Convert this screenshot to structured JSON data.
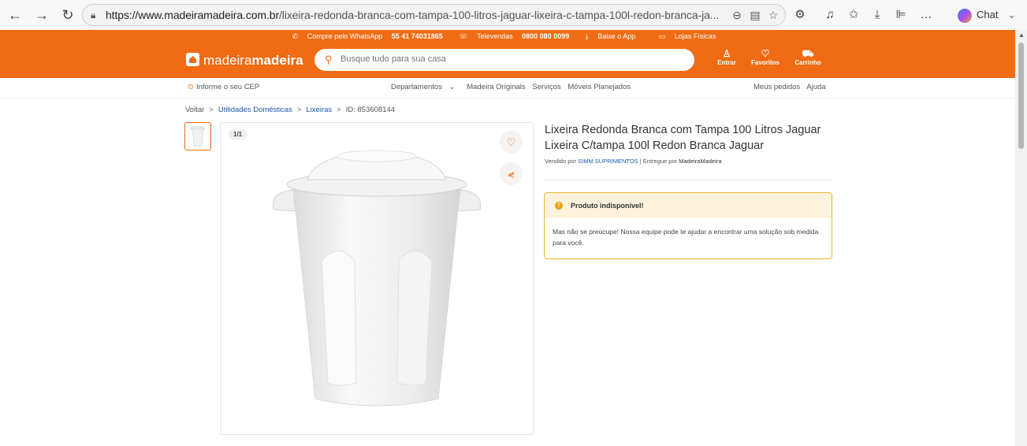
{
  "browser": {
    "url_host": "https://www.madeiramadeira.com.br",
    "url_path": "/lixeira-redonda-branca-com-tampa-100-litros-jaguar-lixeira-c-tampa-100l-redon-branca-ja...",
    "chat_label": "Chat"
  },
  "topstrip": {
    "whatsapp_prefix": "Compre pelo WhatsApp ",
    "whatsapp_number": "55 41 74031865",
    "televendas_prefix": "Televendas ",
    "televendas_number": "0800 080 0099",
    "app": "Baixe o App",
    "stores": "Lojas Físicas"
  },
  "header": {
    "logo_light": "madeira",
    "logo_bold": "madeira",
    "search_placeholder": "Busque tudo para sua casa",
    "login": "Entrar",
    "favorites": "Favoritos",
    "cart": "Carrinho",
    "accent": "#f06b14"
  },
  "subnav": {
    "cep": "Informe o seu CEP",
    "departments": "Departamentos",
    "originals": "Madeira Originals",
    "services": "Serviços",
    "furniture": "Móveis Planejados",
    "orders": "Meus pedidos",
    "help": "Ajuda"
  },
  "breadcrumb": {
    "back": "Voltar",
    "cat1": "Utilidades Domésticas",
    "cat2": "Lixeiras",
    "id": "ID: 853608144"
  },
  "gallery": {
    "counter": "1/1"
  },
  "product": {
    "title": "Lixeira Redonda Branca com Tampa 100 Litros Jaguar Lixeira C/tampa 100l Redon Branca Jaguar",
    "sold_by_label": "Vendido por ",
    "seller": "SIMM SUPRIMENTOS",
    "delivered_label": " | Entregue por ",
    "delivered_by": "MadeiraMadeira"
  },
  "alert": {
    "title": "Produto indisponível!",
    "message": "Mas não se preocupe! Nossa equipe pode te ajudar a encontrar uma solução sob medida para você.",
    "color": "#e7b928"
  }
}
